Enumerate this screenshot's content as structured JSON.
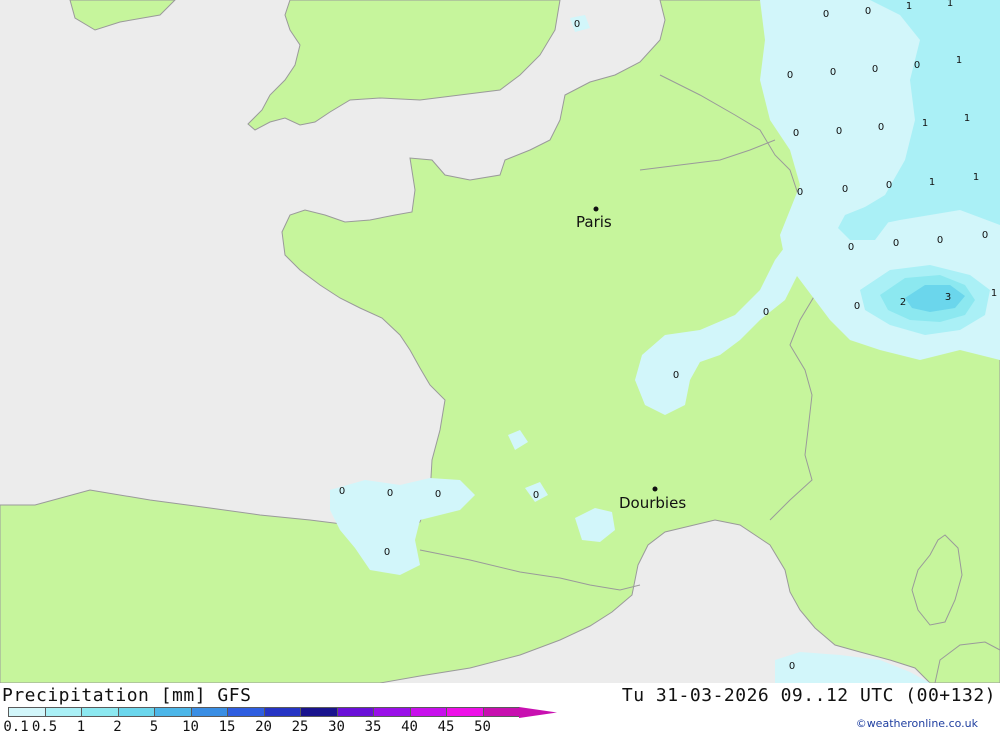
{
  "map": {
    "cities": [
      {
        "name": "Paris"
      },
      {
        "name": "Dourbies"
      }
    ],
    "value_labels": [
      "0",
      "0",
      "1",
      "1",
      "0",
      "0",
      "0",
      "0",
      "1",
      "0",
      "0",
      "0",
      "1",
      "1",
      "0",
      "0",
      "0",
      "1",
      "1",
      "0",
      "0",
      "0",
      "0",
      "2",
      "3",
      "1",
      "0",
      "0",
      "0",
      "0",
      "0",
      "0",
      "0",
      "0",
      "0"
    ]
  },
  "footer": {
    "title": "Precipitation [mm] GFS",
    "datetime": "Tu 31-03-2026 09..12 UTC (00+132)",
    "credit": "©weatheronline.co.uk",
    "legend": [
      {
        "label": "0.1",
        "color": "#d2f6fa"
      },
      {
        "label": "0.5",
        "color": "#aaf0f6"
      },
      {
        "label": "1",
        "color": "#8ce8f0"
      },
      {
        "label": "2",
        "color": "#6bd6ec"
      },
      {
        "label": "5",
        "color": "#4cb6e8"
      },
      {
        "label": "10",
        "color": "#3a8ee4"
      },
      {
        "label": "15",
        "color": "#2f5ee0"
      },
      {
        "label": "20",
        "color": "#2634c4"
      },
      {
        "label": "25",
        "color": "#1a148e"
      },
      {
        "label": "30",
        "color": "#6a10d8"
      },
      {
        "label": "35",
        "color": "#9a10e8"
      },
      {
        "label": "40",
        "color": "#c810ec"
      },
      {
        "label": "45",
        "color": "#ee10e8"
      },
      {
        "label": "50",
        "color": "#c810b0"
      }
    ]
  }
}
